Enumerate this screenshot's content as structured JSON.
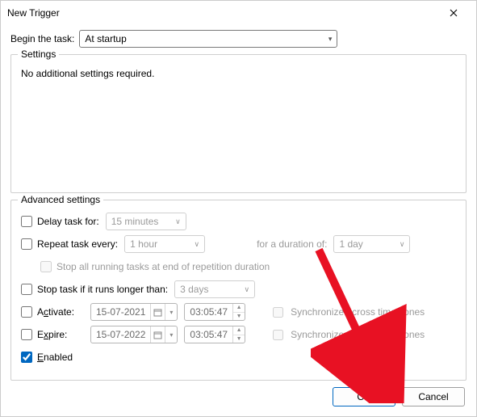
{
  "window": {
    "title": "New Trigger"
  },
  "begin": {
    "label": "Begin the task:",
    "value": "At startup"
  },
  "settings": {
    "legend": "Settings",
    "message": "No additional settings required."
  },
  "advanced": {
    "legend": "Advanced settings",
    "delay": {
      "label": "Delay task for:",
      "value": "15 minutes",
      "checked": false,
      "enabled": true
    },
    "repeat": {
      "label": "Repeat task every:",
      "value": "1 hour",
      "checked": false,
      "duration_label": "for a duration of:",
      "duration_value": "1 day"
    },
    "stop_all": {
      "label": "Stop all running tasks at end of repetition duration",
      "checked": false
    },
    "stop_if": {
      "label": "Stop task if it runs longer than:",
      "value": "3 days",
      "checked": false
    },
    "activate": {
      "label_pre": "A",
      "label_u": "c",
      "label_post": "tivate:",
      "date": "15-07-2021",
      "time": "03:05:47",
      "sync_label": "Synchronize across time zones",
      "checked": false
    },
    "expire": {
      "label_pre": "E",
      "label_u": "x",
      "label_post": "pire:",
      "date": "15-07-2022",
      "time": "03:05:47",
      "sync_label": "Synchronize across time zones",
      "checked": false
    },
    "enabled": {
      "label_pre": "",
      "label_u": "E",
      "label_post": "nabled",
      "checked": true
    }
  },
  "footer": {
    "ok": "OK",
    "cancel": "Cancel"
  }
}
